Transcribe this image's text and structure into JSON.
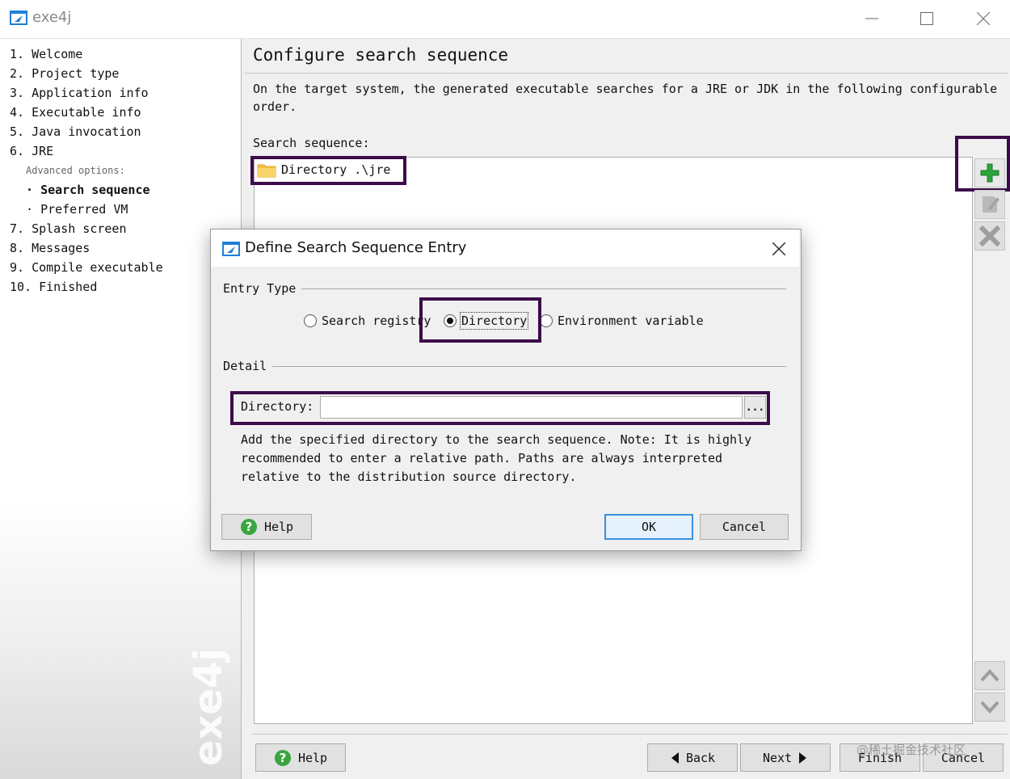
{
  "window": {
    "title": "exe4j"
  },
  "steps": [
    {
      "num": "1.",
      "label": "Welcome"
    },
    {
      "num": "2.",
      "label": "Project type"
    },
    {
      "num": "3.",
      "label": "Application info"
    },
    {
      "num": "4.",
      "label": "Executable info"
    },
    {
      "num": "5.",
      "label": "Java invocation"
    },
    {
      "num": "6.",
      "label": "JRE"
    },
    {
      "num": "7.",
      "label": "Splash screen"
    },
    {
      "num": "8.",
      "label": "Messages"
    },
    {
      "num": "9.",
      "label": "Compile executable"
    },
    {
      "num": "10.",
      "label": "Finished"
    }
  ],
  "advanced": {
    "heading": "Advanced options:",
    "items": [
      {
        "bullet": "·",
        "label": "Search sequence",
        "active": true
      },
      {
        "bullet": "·",
        "label": "Preferred VM",
        "active": false
      }
    ]
  },
  "sidebar_watermark": "exe4j",
  "main": {
    "title": "Configure search sequence",
    "description": "On the target system, the generated executable searches for a JRE or JDK in the following configurable order.",
    "list_label": "Search sequence:",
    "entries": [
      {
        "icon": "folder-icon",
        "text": "Directory .\\jre"
      }
    ],
    "buttons": {
      "help": "Help",
      "back": "Back",
      "next": "Next",
      "finish": "Finish",
      "cancel": "Cancel"
    }
  },
  "dialog": {
    "title": "Define Search Sequence Entry",
    "entry_type_label": "Entry Type",
    "options": [
      {
        "label": "Search registry",
        "selected": false
      },
      {
        "label": "Directory",
        "selected": true
      },
      {
        "label": "Environment variable",
        "selected": false
      }
    ],
    "detail_label": "Detail",
    "directory_label": "Directory:",
    "directory_value": "",
    "browse_label": "...",
    "note": "Add the specified directory to the search sequence. Note: It is highly recommended to enter a relative path. Paths are always interpreted relative to the distribution source directory.",
    "buttons": {
      "help": "Help",
      "ok": "OK",
      "cancel": "Cancel"
    }
  },
  "footer_watermark": "@稀土掘金技术社区",
  "colors": {
    "highlight": "#3c0c4a",
    "add_green": "#2ea43a",
    "help_green": "#3aa53f",
    "ok_border": "#3c8ede"
  }
}
